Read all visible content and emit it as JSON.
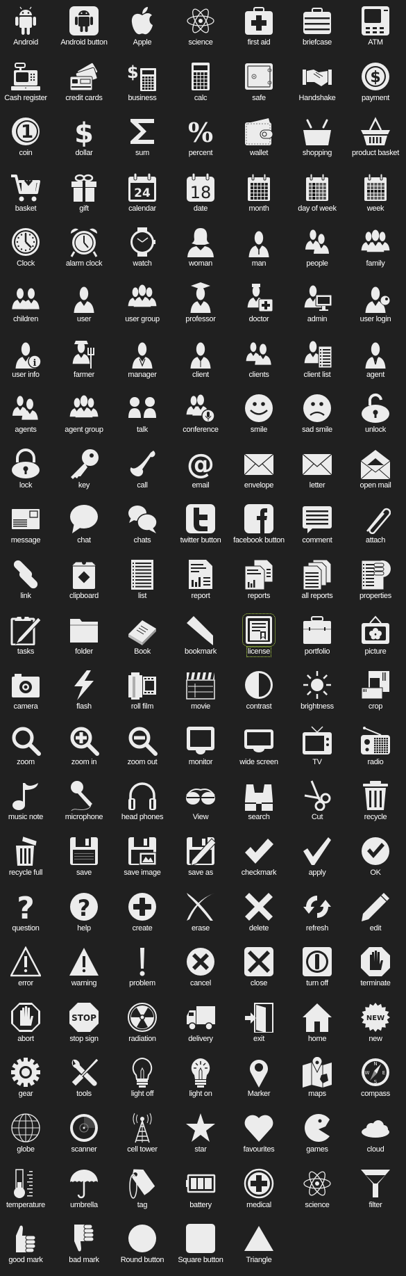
{
  "page": {
    "background": "#202020",
    "icon_color": "#ececec",
    "label_color": "#ffffff",
    "focus_outline_color": "#b8e04a",
    "focused_item": "license"
  },
  "icons": [
    {
      "label": "Android",
      "icon": "android-icon"
    },
    {
      "label": "Android button",
      "icon": "android-button-icon"
    },
    {
      "label": "Apple",
      "icon": "apple-icon"
    },
    {
      "label": "science",
      "icon": "atom-icon"
    },
    {
      "label": "first aid",
      "icon": "first-aid-icon"
    },
    {
      "label": "briefcase",
      "icon": "briefcase-icon"
    },
    {
      "label": "ATM",
      "icon": "atm-icon"
    },
    {
      "label": "Cash register",
      "icon": "cash-register-icon"
    },
    {
      "label": "credit cards",
      "icon": "credit-cards-icon"
    },
    {
      "label": "business",
      "icon": "business-icon"
    },
    {
      "label": "calc",
      "icon": "calculator-icon"
    },
    {
      "label": "safe",
      "icon": "safe-icon"
    },
    {
      "label": "Handshake",
      "icon": "handshake-icon"
    },
    {
      "label": "payment",
      "icon": "payment-icon"
    },
    {
      "label": "coin",
      "icon": "coin-icon"
    },
    {
      "label": "dollar",
      "icon": "dollar-icon"
    },
    {
      "label": "sum",
      "icon": "sigma-icon"
    },
    {
      "label": "percent",
      "icon": "percent-icon"
    },
    {
      "label": "wallet",
      "icon": "wallet-icon"
    },
    {
      "label": "shopping",
      "icon": "shopping-basket-icon"
    },
    {
      "label": "product basket",
      "icon": "product-basket-icon"
    },
    {
      "label": "basket",
      "icon": "cart-icon"
    },
    {
      "label": "gift",
      "icon": "gift-icon"
    },
    {
      "label": "calendar",
      "icon": "calendar-icon",
      "text": "24"
    },
    {
      "label": "date",
      "icon": "date-icon",
      "text": "18"
    },
    {
      "label": "month",
      "icon": "month-icon"
    },
    {
      "label": "day of week",
      "icon": "day-of-week-icon"
    },
    {
      "label": "week",
      "icon": "week-icon"
    },
    {
      "label": "Clock",
      "icon": "clock-icon"
    },
    {
      "label": "alarm clock",
      "icon": "alarm-clock-icon"
    },
    {
      "label": "watch",
      "icon": "watch-icon"
    },
    {
      "label": "woman",
      "icon": "woman-icon"
    },
    {
      "label": "man",
      "icon": "man-icon"
    },
    {
      "label": "people",
      "icon": "people-icon"
    },
    {
      "label": "family",
      "icon": "family-icon"
    },
    {
      "label": "children",
      "icon": "children-icon"
    },
    {
      "label": "user",
      "icon": "user-icon"
    },
    {
      "label": "user group",
      "icon": "user-group-icon"
    },
    {
      "label": "professor",
      "icon": "professor-icon"
    },
    {
      "label": "doctor",
      "icon": "doctor-icon"
    },
    {
      "label": "admin",
      "icon": "admin-icon"
    },
    {
      "label": "user login",
      "icon": "user-login-icon"
    },
    {
      "label": "user info",
      "icon": "user-info-icon"
    },
    {
      "label": "farmer",
      "icon": "farmer-icon"
    },
    {
      "label": "manager",
      "icon": "manager-icon"
    },
    {
      "label": "client",
      "icon": "client-icon"
    },
    {
      "label": "clients",
      "icon": "clients-icon"
    },
    {
      "label": "client list",
      "icon": "client-list-icon"
    },
    {
      "label": "agent",
      "icon": "agent-icon"
    },
    {
      "label": "agents",
      "icon": "agents-icon"
    },
    {
      "label": "agent group",
      "icon": "agent-group-icon"
    },
    {
      "label": "talk",
      "icon": "talk-icon"
    },
    {
      "label": "conference",
      "icon": "conference-icon"
    },
    {
      "label": "smile",
      "icon": "smile-icon"
    },
    {
      "label": "sad smile",
      "icon": "sad-smile-icon"
    },
    {
      "label": "unlock",
      "icon": "unlock-icon"
    },
    {
      "label": "lock",
      "icon": "lock-icon"
    },
    {
      "label": "key",
      "icon": "key-icon"
    },
    {
      "label": "call",
      "icon": "phone-icon"
    },
    {
      "label": "email",
      "icon": "at-sign-icon"
    },
    {
      "label": "envelope",
      "icon": "envelope-icon"
    },
    {
      "label": "letter",
      "icon": "letter-icon"
    },
    {
      "label": "open mail",
      "icon": "open-mail-icon"
    },
    {
      "label": "message",
      "icon": "message-icon"
    },
    {
      "label": "chat",
      "icon": "chat-bubble-icon"
    },
    {
      "label": "chats",
      "icon": "chats-icon"
    },
    {
      "label": "twitter button",
      "icon": "twitter-icon"
    },
    {
      "label": "facebook button",
      "icon": "facebook-icon"
    },
    {
      "label": "comment",
      "icon": "comment-icon"
    },
    {
      "label": "attach",
      "icon": "paperclip-icon"
    },
    {
      "label": "link",
      "icon": "link-icon"
    },
    {
      "label": "clipboard",
      "icon": "clipboard-icon"
    },
    {
      "label": "list",
      "icon": "list-icon"
    },
    {
      "label": "report",
      "icon": "report-icon"
    },
    {
      "label": "reports",
      "icon": "reports-icon"
    },
    {
      "label": "all reports",
      "icon": "all-reports-icon"
    },
    {
      "label": "properties",
      "icon": "properties-icon"
    },
    {
      "label": "tasks",
      "icon": "tasks-icon"
    },
    {
      "label": "folder",
      "icon": "folder-icon"
    },
    {
      "label": "Book",
      "icon": "book-icon"
    },
    {
      "label": "bookmark",
      "icon": "bookmark-icon"
    },
    {
      "label": "license",
      "icon": "license-icon"
    },
    {
      "label": "portfolio",
      "icon": "portfolio-icon"
    },
    {
      "label": "picture",
      "icon": "picture-icon"
    },
    {
      "label": "camera",
      "icon": "camera-icon"
    },
    {
      "label": "flash",
      "icon": "flash-icon"
    },
    {
      "label": "roll film",
      "icon": "roll-film-icon"
    },
    {
      "label": "movie",
      "icon": "clapperboard-icon"
    },
    {
      "label": "contrast",
      "icon": "contrast-icon"
    },
    {
      "label": "brightness",
      "icon": "brightness-icon"
    },
    {
      "label": "crop",
      "icon": "crop-icon"
    },
    {
      "label": "zoom",
      "icon": "magnifier-icon"
    },
    {
      "label": "zoom in",
      "icon": "zoom-in-icon"
    },
    {
      "label": "zoom out",
      "icon": "zoom-out-icon"
    },
    {
      "label": "monitor",
      "icon": "monitor-icon"
    },
    {
      "label": "wide screen",
      "icon": "wide-screen-icon"
    },
    {
      "label": "TV",
      "icon": "tv-icon"
    },
    {
      "label": "radio",
      "icon": "radio-icon"
    },
    {
      "label": "music note",
      "icon": "music-note-icon"
    },
    {
      "label": "microphone",
      "icon": "microphone-icon"
    },
    {
      "label": "head phones",
      "icon": "headphones-icon"
    },
    {
      "label": "View",
      "icon": "glasses-icon"
    },
    {
      "label": "search",
      "icon": "binoculars-icon"
    },
    {
      "label": "Cut",
      "icon": "scissors-icon"
    },
    {
      "label": "recycle",
      "icon": "trash-icon"
    },
    {
      "label": "recycle full",
      "icon": "trash-full-icon"
    },
    {
      "label": "save",
      "icon": "floppy-icon"
    },
    {
      "label": "save image",
      "icon": "save-image-icon"
    },
    {
      "label": "save as",
      "icon": "save-as-icon"
    },
    {
      "label": "checkmark",
      "icon": "checkmark-icon"
    },
    {
      "label": "apply",
      "icon": "apply-icon"
    },
    {
      "label": "OK",
      "icon": "ok-circle-icon"
    },
    {
      "label": "question",
      "icon": "question-icon"
    },
    {
      "label": "help",
      "icon": "help-circle-icon"
    },
    {
      "label": "create",
      "icon": "plus-circle-icon"
    },
    {
      "label": "erase",
      "icon": "erase-icon"
    },
    {
      "label": "delete",
      "icon": "x-icon"
    },
    {
      "label": "refresh",
      "icon": "refresh-icon"
    },
    {
      "label": "edit",
      "icon": "pencil-icon"
    },
    {
      "label": "error",
      "icon": "error-triangle-icon"
    },
    {
      "label": "warning",
      "icon": "warning-icon"
    },
    {
      "label": "problem",
      "icon": "exclamation-icon"
    },
    {
      "label": "cancel",
      "icon": "cancel-circle-icon"
    },
    {
      "label": "close",
      "icon": "close-square-icon"
    },
    {
      "label": "turn off",
      "icon": "power-icon"
    },
    {
      "label": "terminate",
      "icon": "terminate-hand-icon"
    },
    {
      "label": "abort",
      "icon": "abort-hand-icon"
    },
    {
      "label": "stop sign",
      "icon": "stop-sign-icon",
      "text": "STOP"
    },
    {
      "label": "radiation",
      "icon": "radiation-icon"
    },
    {
      "label": "delivery",
      "icon": "truck-icon"
    },
    {
      "label": "exit",
      "icon": "exit-door-icon"
    },
    {
      "label": "home",
      "icon": "house-icon"
    },
    {
      "label": "new",
      "icon": "new-badge-icon",
      "text": "NEW"
    },
    {
      "label": "gear",
      "icon": "gear-icon"
    },
    {
      "label": "tools",
      "icon": "tools-icon"
    },
    {
      "label": "light off",
      "icon": "bulb-off-icon"
    },
    {
      "label": "light on",
      "icon": "bulb-on-icon"
    },
    {
      "label": "Marker",
      "icon": "map-marker-icon"
    },
    {
      "label": "maps",
      "icon": "map-icon"
    },
    {
      "label": "compass",
      "icon": "compass-icon"
    },
    {
      "label": "globe",
      "icon": "globe-icon"
    },
    {
      "label": "scanner",
      "icon": "scanner-icon"
    },
    {
      "label": "cell tower",
      "icon": "cell-tower-icon"
    },
    {
      "label": "star",
      "icon": "star-icon"
    },
    {
      "label": "favourites",
      "icon": "heart-icon"
    },
    {
      "label": "games",
      "icon": "pacman-icon"
    },
    {
      "label": "cloud",
      "icon": "cloud-icon"
    },
    {
      "label": "temperature",
      "icon": "thermometer-icon"
    },
    {
      "label": "umbrella",
      "icon": "umbrella-icon"
    },
    {
      "label": "tag",
      "icon": "tag-icon"
    },
    {
      "label": "battery",
      "icon": "battery-icon"
    },
    {
      "label": "medical",
      "icon": "medical-icon"
    },
    {
      "label": "science",
      "icon": "atom-icon"
    },
    {
      "label": "filter",
      "icon": "funnel-icon"
    },
    {
      "label": "good mark",
      "icon": "thumbs-up-icon"
    },
    {
      "label": "bad mark",
      "icon": "thumbs-down-icon"
    },
    {
      "label": "Round button",
      "icon": "circle-icon"
    },
    {
      "label": "Square button",
      "icon": "square-icon"
    },
    {
      "label": "Triangle",
      "icon": "triangle-icon"
    }
  ]
}
